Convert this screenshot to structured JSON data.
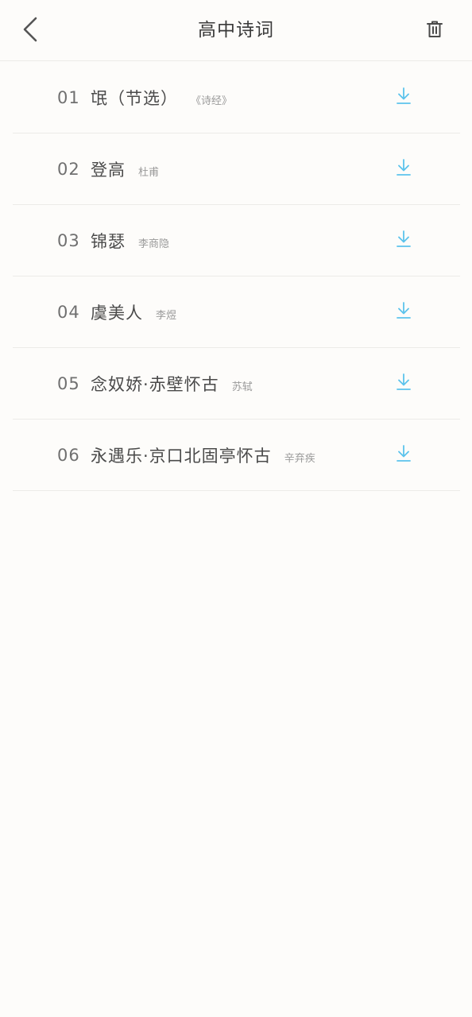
{
  "header": {
    "title": "高中诗词",
    "back_icon": "back-arrow-icon",
    "delete_icon": "trash-icon"
  },
  "colors": {
    "accent": "#5cc3ec",
    "background": "#fdfcfa",
    "divider": "#ecebe8",
    "title_text": "#3a3a3a",
    "number_text": "#707070",
    "name_text": "#4a4a4a",
    "author_text": "#9a9a9a"
  },
  "poems": [
    {
      "num": "01",
      "name": "氓（节选）",
      "author": "《诗经》",
      "icon": "download-icon"
    },
    {
      "num": "02",
      "name": "登高",
      "author": "杜甫",
      "icon": "download-icon"
    },
    {
      "num": "03",
      "name": "锦瑟",
      "author": "李商隐",
      "icon": "download-icon"
    },
    {
      "num": "04",
      "name": "虞美人",
      "author": "李煜",
      "icon": "download-icon"
    },
    {
      "num": "05",
      "name": "念奴娇·赤壁怀古",
      "author": "苏轼",
      "icon": "download-icon"
    },
    {
      "num": "06",
      "name": "永遇乐·京口北固亭怀古",
      "author": "辛弃疾",
      "icon": "download-icon"
    }
  ]
}
